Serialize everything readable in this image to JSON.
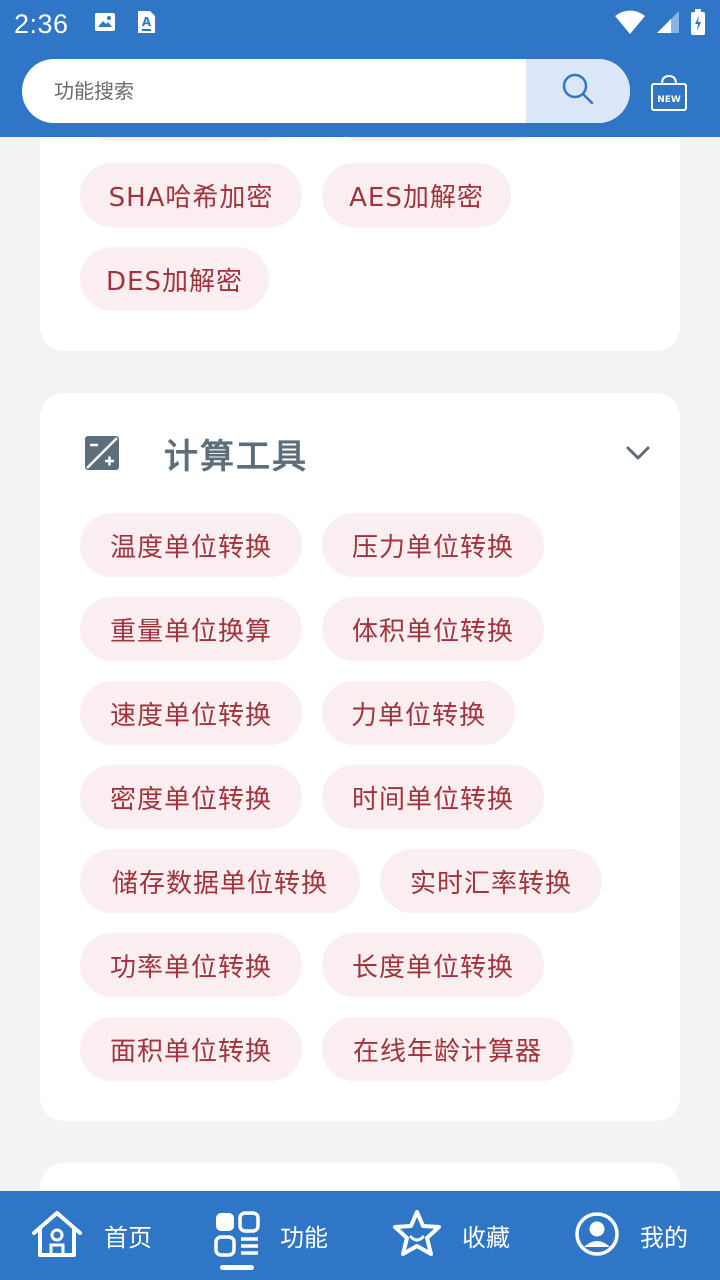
{
  "status_bar": {
    "time": "2:36",
    "left_icons": [
      "image-icon",
      "a11y-icon"
    ],
    "right_icons": [
      "wifi-icon",
      "signal-icon",
      "battery-icon"
    ]
  },
  "search": {
    "placeholder": "功能搜索",
    "value": "",
    "button_icon": "search-icon",
    "new_badge": "NEW"
  },
  "encryption_section": {
    "chips": [
      "SHA哈希加密",
      "AES加解密",
      "DES加解密"
    ]
  },
  "calc_section": {
    "title": "计算工具",
    "icon": "exposure-icon",
    "expand_icon": "chevron-down-icon",
    "chips": [
      "温度单位转换",
      "压力单位转换",
      "重量单位换算",
      "体积单位转换",
      "速度单位转换",
      "力单位转换",
      "密度单位转换",
      "时间单位转换",
      "储存数据单位转换",
      "实时汇率转换",
      "功率单位转换",
      "长度单位转换",
      "面积单位转换",
      "在线年龄计算器"
    ]
  },
  "bottom_nav": {
    "items": [
      {
        "label": "首页",
        "icon": "home-icon"
      },
      {
        "label": "功能",
        "icon": "apps-icon"
      },
      {
        "label": "收藏",
        "icon": "star-icon"
      },
      {
        "label": "我的",
        "icon": "user-icon"
      }
    ],
    "active_index": 1
  },
  "colors": {
    "primary": "#2f77c6",
    "chip_bg": "#fbeef0",
    "chip_text": "#a2323b",
    "title_text": "#5d6e7a"
  }
}
